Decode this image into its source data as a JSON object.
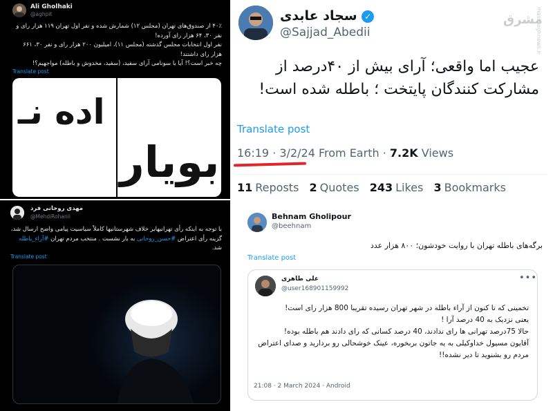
{
  "panel1": {
    "name": "Ali Gholhaki",
    "handle": "@aghpit",
    "body": [
      "۴۰٪ از صندوق‌های تهران (مجلس ۱۲) شمارش شده و نفر اول تهران ۱۱۹ هزار رای و نفر ۳۰، ۶۴ هزار رای آورده!",
      "نفر اول انتخابات مجلس گذشته (مجلس ۱۱)، امیلیون ۲۰۰ هزار رای و نفر ۳۰، ۶۶۱ هزار رای داشتند!",
      "چه خبر است؟! آیا با سونامی آرای سفید، (سفید، مخدوش و باطله) مواجهیم؟!"
    ],
    "translate": "Translate post",
    "media_left_text": "اده نـ",
    "media_right_text": "بویار"
  },
  "panel2": {
    "name": "سجاد عابدی",
    "handle": "@Sajjad_Abedii",
    "text": "عجیب اما واقعی؛ آرای بیش از ۴۰درصد از مشارکت کنندگان پایتخت ؛ باطله شده است!",
    "translate": "Translate post",
    "time": "16:19 · 3/2/24",
    "source": "From Earth ·",
    "views_count": "7.2K",
    "views_label": "Views",
    "watermark": "مشرق",
    "watermark_side": "mashreghnews.ir",
    "stats": [
      {
        "count": "11",
        "label": "Reposts"
      },
      {
        "count": "2",
        "label": "Quotes"
      },
      {
        "count": "243",
        "label": "Likes"
      },
      {
        "count": "3",
        "label": "Bookmarks"
      }
    ]
  },
  "panel3": {
    "name": "مهدی روحانی فرد",
    "handle": "@MehdiRohanii",
    "body_before": "با توجه به اینکه رأی تهرانیهابر خلاف شهرستانیها کاملاً سیاسیت پیامی واضح ارسال شد، گزینه رأی اعتراض",
    "hashtag1": "#حسن_روحانی",
    "body_mid": "به بار نشست . منتخب مردم تهران",
    "hashtag2": "#آراء_باطله",
    "body_end": "شد.",
    "translate": "Translate post"
  },
  "panel4": {
    "name": "Behnam Gholipour",
    "handle": "@beehnam",
    "body": "برگه‌های باطله تهران با روایت خودشون؛ ۸۰۰ هزار عدد",
    "translate": "Translate post",
    "quote": {
      "name": "علی طاهری",
      "handle": "@user168901159992",
      "lines": [
        "تخمینی که تا کنون از آراء باطله در شهر تهران رسیده تقریبا 800 هزار رای است!",
        "یعنی نزدیک به 40 درصد آرا !",
        "حالا 75درصد تهرانی ها رای ندادند، 40 درصد کسانی که رای دادند هم باطله بوده!",
        "آقایون مسیول خداوکیلی به یه جاتون بربخوره، عینک خوشحالی رو بردارید و صدای اعتراض مردم رو بشنوید تا دیر نشده!!"
      ],
      "time": "21:08 · 2 March 2024 · Android"
    }
  },
  "colors": {
    "twitter_blue": "#1d9bf0",
    "highlight_red": "#e3242b",
    "dark_bg": "#000000"
  }
}
